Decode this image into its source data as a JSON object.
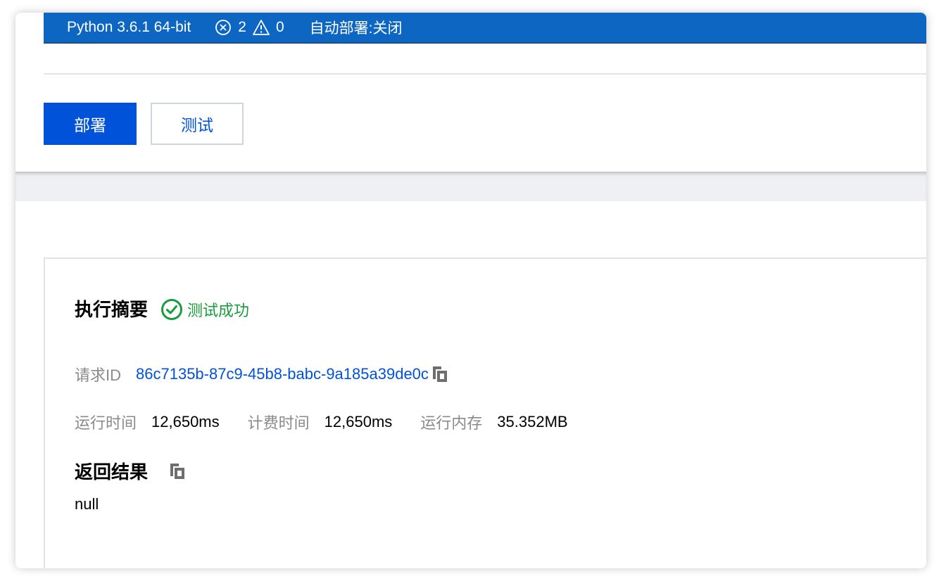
{
  "status_bar": {
    "python_version": "Python 3.6.1 64-bit",
    "error_count": "2",
    "warning_count": "0",
    "auto_deploy": "自动部署:关闭"
  },
  "toolbar": {
    "deploy_label": "部署",
    "test_label": "测试"
  },
  "result": {
    "summary_title": "执行摘要",
    "status_text": "测试成功",
    "request_id_label": "请求ID",
    "request_id_value": "86c7135b-87c9-45b8-babc-9a185a39de0c",
    "run_time_label": "运行时间",
    "run_time_value": "12,650ms",
    "billed_time_label": "计费时间",
    "billed_time_value": "12,650ms",
    "memory_label": "运行内存",
    "memory_value": "35.352MB",
    "return_title": "返回结果",
    "return_value": "null"
  },
  "colors": {
    "status_bar_bg": "#0d66c2",
    "primary": "#0052d9",
    "success": "#1a9c3c"
  },
  "icons": {
    "error": "error-circle-icon",
    "warning": "warning-triangle-icon",
    "success": "check-circle-icon",
    "copy": "copy-icon"
  }
}
